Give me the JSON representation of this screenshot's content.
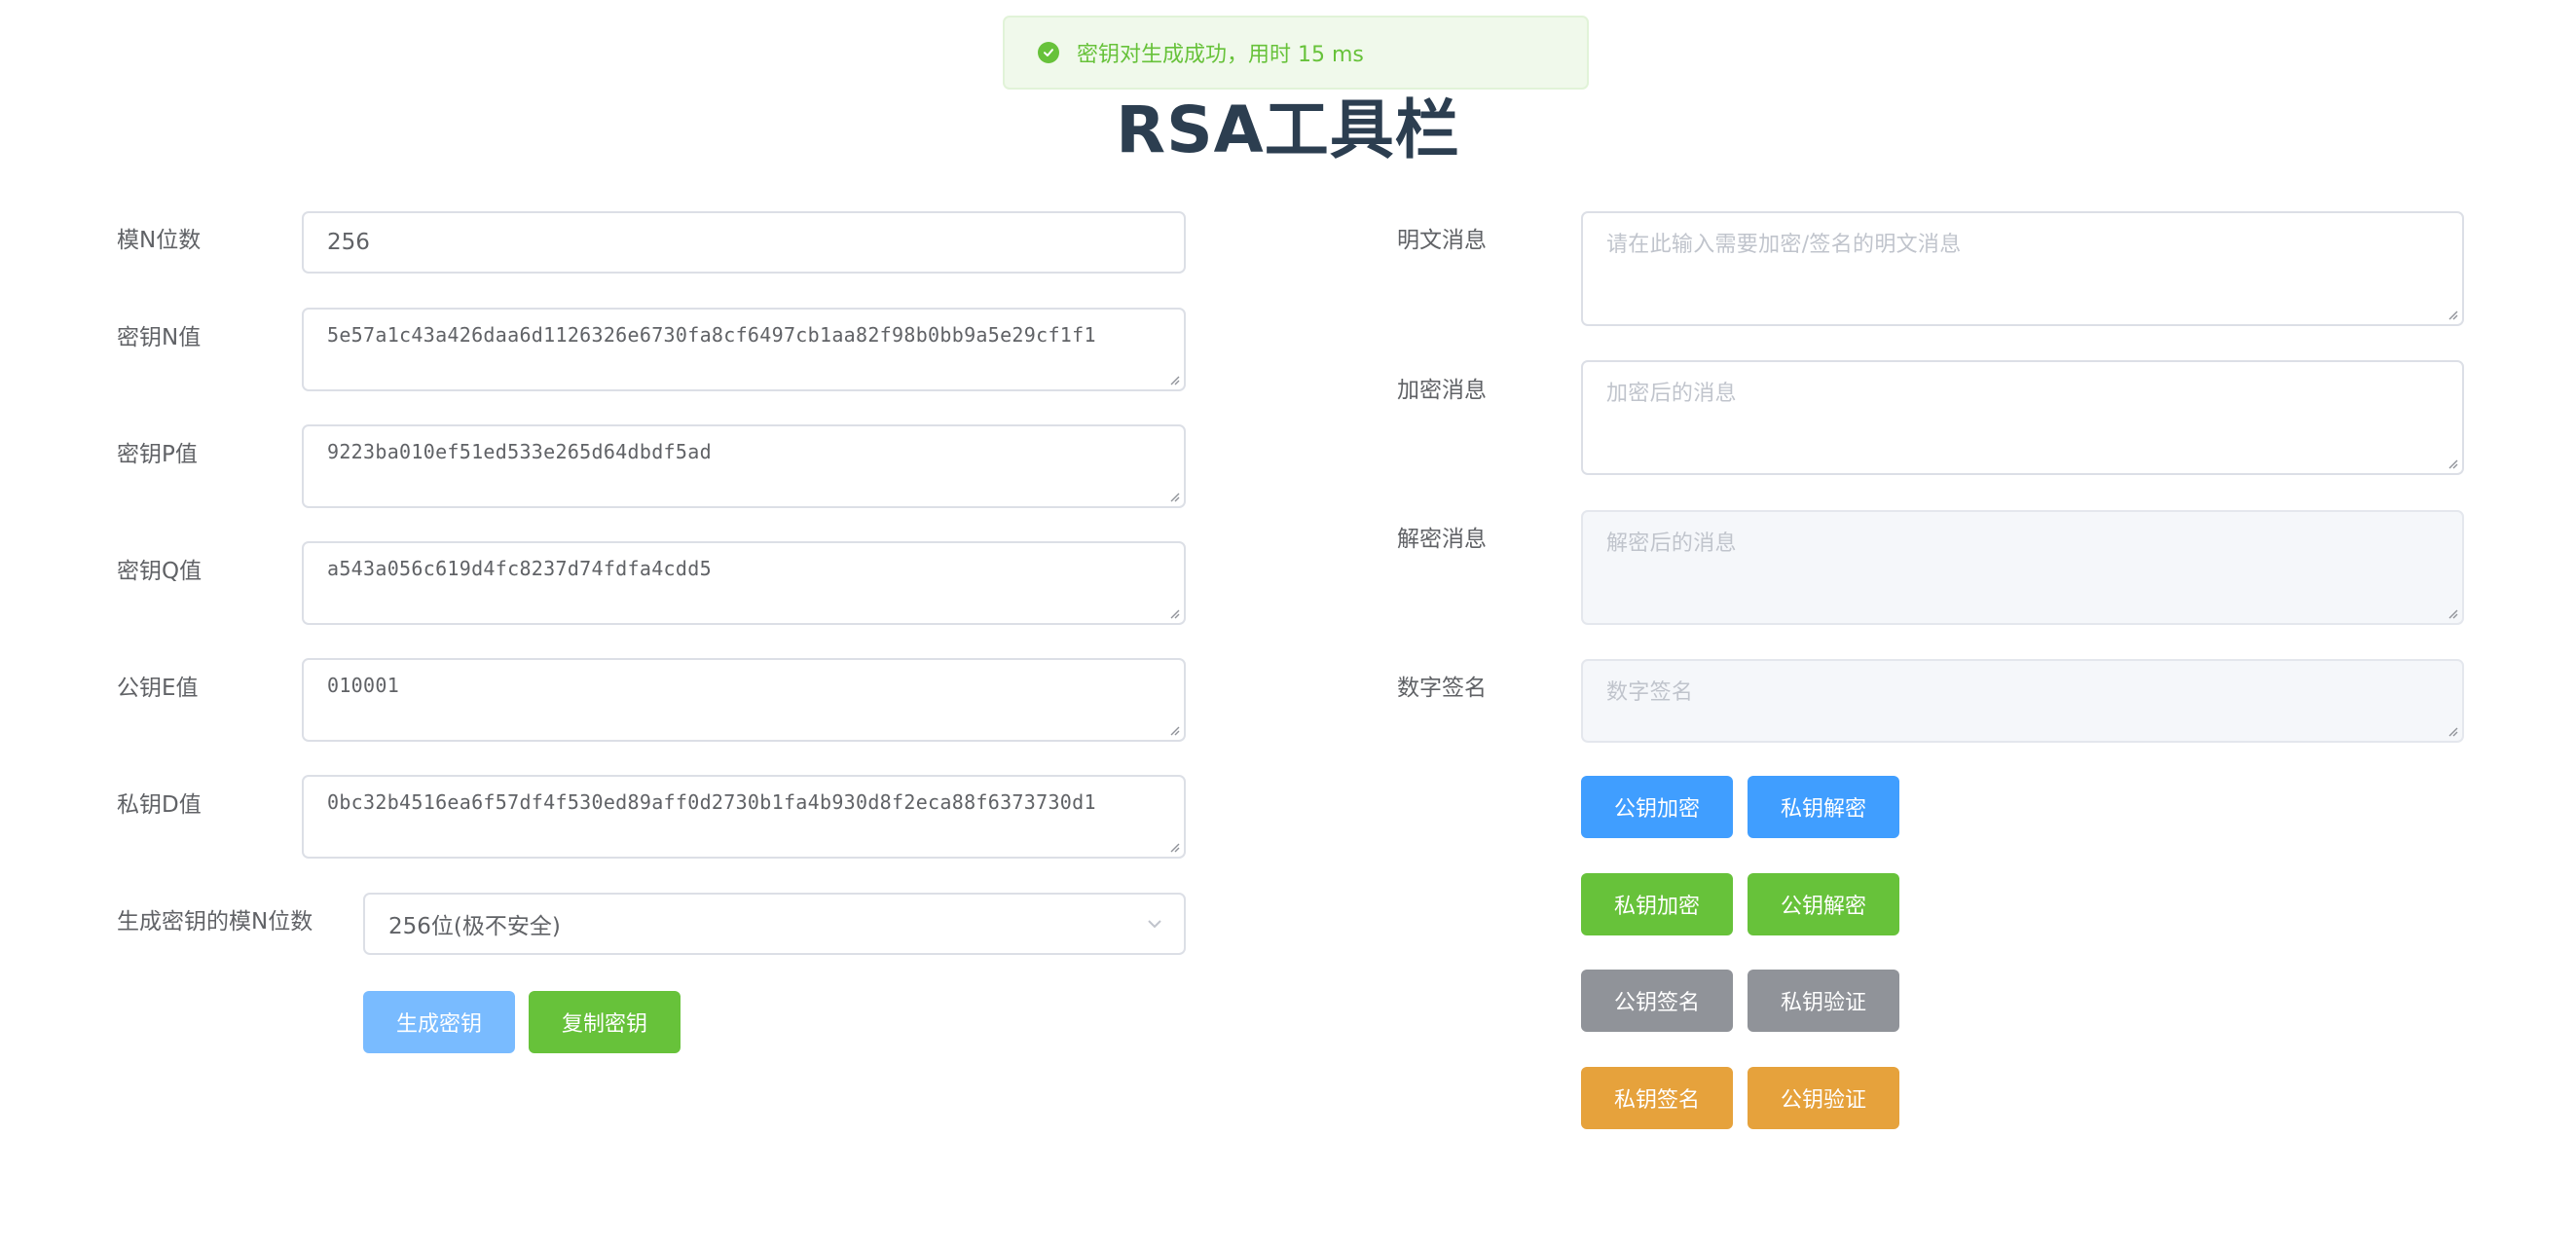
{
  "toast": {
    "message": "密钥对生成成功，用时 15 ms",
    "icon": "check-circle-icon",
    "color": "#67c23a"
  },
  "title": "RSA工具栏",
  "left_form": {
    "modulus_bits": {
      "label": "模N位数",
      "value": "256"
    },
    "key_n": {
      "label": "密钥N值",
      "value": "5e57a1c43a426daa6d1126326e6730fa8cf6497cb1aa82f98b0bb9a5e29cf1f1"
    },
    "key_p": {
      "label": "密钥P值",
      "value": "9223ba010ef51ed533e265d64dbdf5ad"
    },
    "key_q": {
      "label": "密钥Q值",
      "value": "a543a056c619d4fc8237d74fdfa4cdd5"
    },
    "public_e": {
      "label": "公钥E值",
      "value": "010001"
    },
    "private_d": {
      "label": "私钥D值",
      "value": "0bc32b4516ea6f57df4f530ed89aff0d2730b1fa4b930d8f2eca88f6373730d1"
    },
    "gen_bits": {
      "label": "生成密钥的模N位数",
      "selected": "256位(极不安全)"
    },
    "buttons": {
      "generate": "生成密钥",
      "copy": "复制密钥"
    }
  },
  "right_form": {
    "plaintext": {
      "label": "明文消息",
      "placeholder": "请在此输入需要加密/签名的明文消息"
    },
    "encrypted": {
      "label": "加密消息",
      "placeholder": "加密后的消息"
    },
    "decrypted": {
      "label": "解密消息",
      "placeholder": "解密后的消息"
    },
    "signature": {
      "label": "数字签名",
      "placeholder": "数字签名"
    },
    "buttons": {
      "pub_encrypt": "公钥加密",
      "priv_decrypt": "私钥解密",
      "priv_encrypt": "私钥加密",
      "pub_decrypt": "公钥解密",
      "pub_sign": "公钥签名",
      "priv_verify": "私钥验证",
      "priv_sign": "私钥签名",
      "pub_verify": "公钥验证"
    }
  },
  "colors": {
    "primary": "#409eff",
    "success": "#67c23a",
    "info": "#909399",
    "warning": "#e6a23c",
    "title": "#2c3e50"
  }
}
